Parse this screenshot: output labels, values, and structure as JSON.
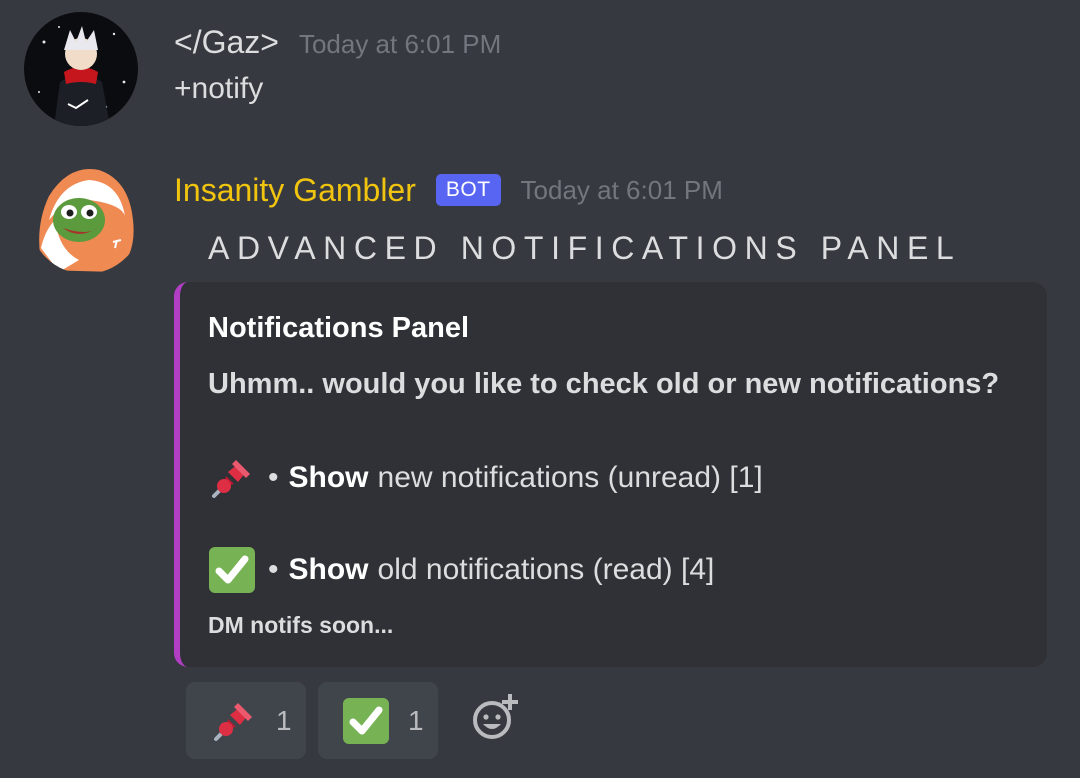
{
  "messages": [
    {
      "author": "</Gaz>",
      "avatar": "anime-character-avatar",
      "timestamp": "Today at 6:01 PM",
      "content": "+notify"
    },
    {
      "author": "Insanity Gambler",
      "author_color": "#f1c40f",
      "bot_tag": "BOT",
      "avatar": "pepe-in-blanket-avatar",
      "timestamp": "Today at 6:01 PM",
      "content": "ADVANCED NOTIFICATIONS PANEL",
      "embed": {
        "accent_color": "#b23ec4",
        "title": "Notifications Panel",
        "description": "Uhmm.. would you like to check old or new notifications?",
        "options": [
          {
            "emoji": "pushpin-icon",
            "bullet": "•",
            "bold": "Show",
            "text": "new notifications (unread) [1]"
          },
          {
            "emoji": "check-mark-icon",
            "bullet": "•",
            "bold": "Show",
            "text": "old notifications (read) [4]"
          }
        ],
        "footer": "DM notifs soon..."
      },
      "reactions": [
        {
          "emoji": "pushpin-icon",
          "count": "1"
        },
        {
          "emoji": "check-mark-icon",
          "count": "1"
        }
      ],
      "add_reaction_icon": "add-reaction-icon"
    }
  ]
}
